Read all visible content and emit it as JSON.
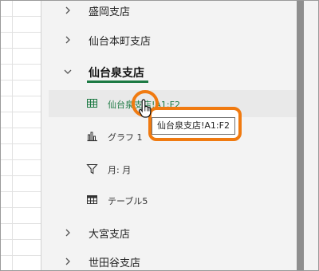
{
  "nav": {
    "items": [
      {
        "label": "盛岡支店"
      },
      {
        "label": "仙台本町支店"
      },
      {
        "label": "仙台泉支店"
      },
      {
        "label": "大宮支店"
      },
      {
        "label": "世田谷支店"
      }
    ],
    "children": [
      {
        "label": "仙台泉支店!A1:F2"
      },
      {
        "label": "グラフ 1"
      },
      {
        "label": "月: 月"
      },
      {
        "label": "テーブル5"
      }
    ]
  },
  "tooltip": {
    "text": "仙台泉支店!A1:F2"
  },
  "colors": {
    "accent": "#1d7a44",
    "highlight": "#f07a10"
  }
}
